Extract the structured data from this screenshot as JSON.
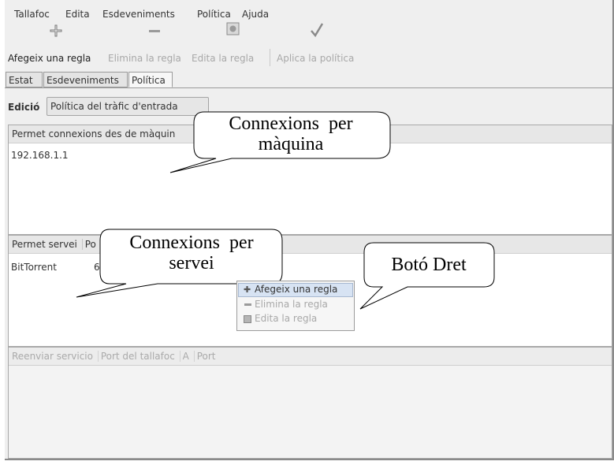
{
  "menubar": {
    "items": [
      {
        "label": "Tallafoc"
      },
      {
        "label": "Edita"
      },
      {
        "label": "Esdeveniments"
      },
      {
        "label": "Política"
      },
      {
        "label": "Ajuda"
      }
    ]
  },
  "toolbar": {
    "add_rule": "Afegeix una regla",
    "remove_rule": "Elimina la regla",
    "edit_rule": "Edita la regla",
    "apply_policy": "Aplica la política"
  },
  "tabs": [
    {
      "label": "Estat"
    },
    {
      "label": "Esdeveniments"
    },
    {
      "label": "Política"
    }
  ],
  "edit_row": {
    "label": "Edició",
    "selected_policy": "Política del tràfic d'entrada"
  },
  "host_panel": {
    "header": "Permet connexions des de màquin",
    "rows": [
      "192.168.1.1"
    ]
  },
  "service_panel": {
    "header_service": "Permet servei",
    "header_port": "Po",
    "rows": [
      {
        "service": "BitTorrent",
        "port": "6"
      }
    ]
  },
  "forward_panel": {
    "headers": [
      "Reenviar servicio",
      "Port del tallafoc",
      "A",
      "Port"
    ]
  },
  "context_menu": {
    "items": [
      "Afegeix una regla",
      "Elimina la regla",
      "Edita la regla"
    ]
  },
  "callouts": {
    "host": {
      "line1": "Connexions  per",
      "line2": "màquina"
    },
    "service": {
      "line1": "Connexions  per",
      "line2": "servei"
    },
    "right_click": {
      "text": "Botó Dret"
    }
  },
  "colors": {
    "window_bg": "#efefef",
    "header_bg": "#e7e7e7",
    "context_highlight": "#d7e3f3",
    "disabled_text": "#a8a8a8"
  }
}
